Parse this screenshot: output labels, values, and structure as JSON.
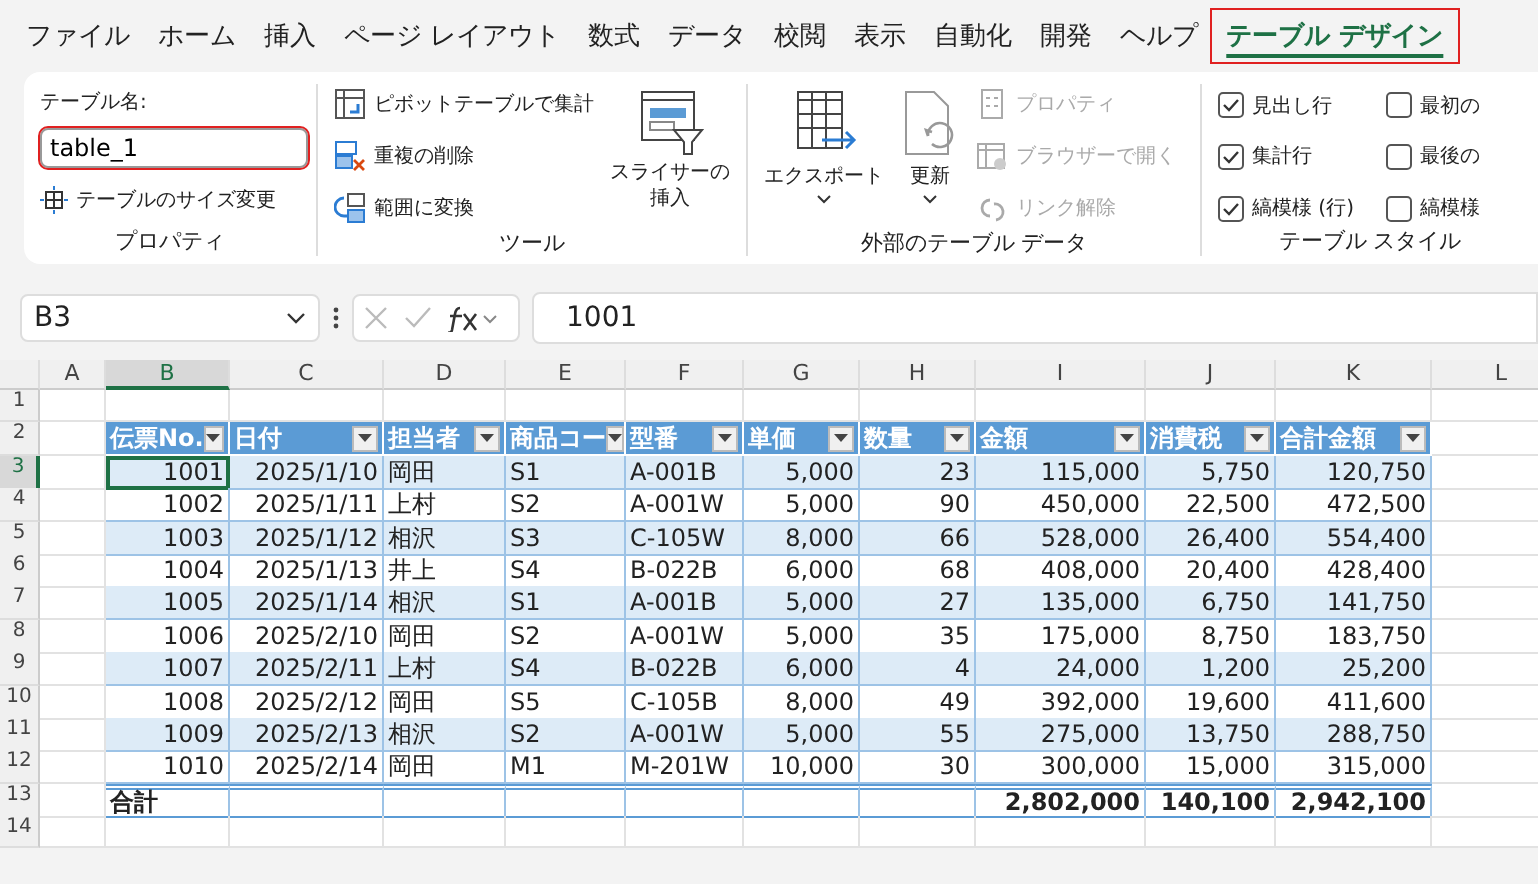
{
  "menu_tabs": [
    {
      "label": "ファイル",
      "selected": false,
      "annotated": false
    },
    {
      "label": "ホーム",
      "selected": false,
      "annotated": false
    },
    {
      "label": "挿入",
      "selected": false,
      "annotated": false
    },
    {
      "label": "ページ レイアウト",
      "selected": false,
      "annotated": false
    },
    {
      "label": "数式",
      "selected": false,
      "annotated": false
    },
    {
      "label": "データ",
      "selected": false,
      "annotated": false
    },
    {
      "label": "校閲",
      "selected": false,
      "annotated": false
    },
    {
      "label": "表示",
      "selected": false,
      "annotated": false
    },
    {
      "label": "自動化",
      "selected": false,
      "annotated": false
    },
    {
      "label": "開発",
      "selected": false,
      "annotated": false
    },
    {
      "label": "ヘルプ",
      "selected": false,
      "annotated": false
    },
    {
      "label": "テーブル デザイン",
      "selected": true,
      "annotated": true
    }
  ],
  "ribbon": {
    "properties": {
      "caption": "テーブル名:",
      "table_name": "table_1",
      "annotated": true,
      "resize_button": "テーブルのサイズ変更",
      "title": "プロパティ"
    },
    "tools": {
      "buttons": [
        {
          "label": "ピボットテーブルで集計",
          "kind": "pivot"
        },
        {
          "label": "重複の削除",
          "kind": "dedupe"
        },
        {
          "label": "範囲に変換",
          "kind": "convert"
        }
      ],
      "slicer_button": [
        "スライサーの",
        "挿入"
      ],
      "title": "ツール"
    },
    "external": {
      "export_button": "エクスポート",
      "refresh_button": "更新",
      "buttons": [
        {
          "label": "プロパティ",
          "kind": "props",
          "disabled": true
        },
        {
          "label": "ブラウザーで開く",
          "kind": "browser",
          "disabled": true
        },
        {
          "label": "リンク解除",
          "kind": "unlink",
          "disabled": true
        }
      ],
      "title": "外部のテーブル データ"
    },
    "style_options": {
      "options": [
        {
          "label": "見出し行",
          "checked": true
        },
        {
          "label": "最初の",
          "checked": false
        },
        {
          "label": "集計行",
          "checked": true
        },
        {
          "label": "最後の",
          "checked": false
        },
        {
          "label": "縞模様 (行)",
          "checked": true
        },
        {
          "label": "縞模様",
          "checked": false
        }
      ],
      "title": "テーブル スタイル"
    }
  },
  "formula_bar": {
    "name_box": "B3",
    "formula": "1001"
  },
  "sheet": {
    "columns": [
      {
        "letter": "A",
        "selected": false
      },
      {
        "letter": "B",
        "selected": true
      },
      {
        "letter": "C",
        "selected": false
      },
      {
        "letter": "D",
        "selected": false
      },
      {
        "letter": "E",
        "selected": false
      },
      {
        "letter": "F",
        "selected": false
      },
      {
        "letter": "G",
        "selected": false
      },
      {
        "letter": "H",
        "selected": false
      },
      {
        "letter": "I",
        "selected": false
      },
      {
        "letter": "J",
        "selected": false
      },
      {
        "letter": "K",
        "selected": false
      },
      {
        "letter": "L",
        "selected": false
      }
    ],
    "row_numbers": [
      {
        "label": "1",
        "selected": false
      },
      {
        "label": "2",
        "selected": false
      },
      {
        "label": "3",
        "selected": true
      },
      {
        "label": "4",
        "selected": false
      },
      {
        "label": "5",
        "selected": false
      },
      {
        "label": "6",
        "selected": false
      },
      {
        "label": "7",
        "selected": false
      },
      {
        "label": "8",
        "selected": false
      },
      {
        "label": "9",
        "selected": false
      },
      {
        "label": "10",
        "selected": false
      },
      {
        "label": "11",
        "selected": false
      },
      {
        "label": "12",
        "selected": false
      },
      {
        "label": "13",
        "selected": false
      },
      {
        "label": "14",
        "selected": false
      }
    ],
    "table": {
      "columns": [
        {
          "header": "伝票No.",
          "kind": "number"
        },
        {
          "header": "日付",
          "kind": "number"
        },
        {
          "header": "担当者",
          "kind": "text"
        },
        {
          "header": "商品コー",
          "kind": "text"
        },
        {
          "header": "型番",
          "kind": "text"
        },
        {
          "header": "単価",
          "kind": "number"
        },
        {
          "header": "数量",
          "kind": "number"
        },
        {
          "header": "金額",
          "kind": "number"
        },
        {
          "header": "消費税",
          "kind": "number"
        },
        {
          "header": "合計金額",
          "kind": "number"
        }
      ],
      "rows": [
        {
          "cells": [
            "1001",
            "2025/1/10",
            "岡田",
            "S1",
            "A-001B",
            "5,000",
            "23",
            "115,000",
            "5,750",
            "120,750"
          ],
          "selected": true
        },
        {
          "cells": [
            "1002",
            "2025/1/11",
            "上村",
            "S2",
            "A-001W",
            "5,000",
            "90",
            "450,000",
            "22,500",
            "472,500"
          ],
          "selected": false
        },
        {
          "cells": [
            "1003",
            "2025/1/12",
            "相沢",
            "S3",
            "C-105W",
            "8,000",
            "66",
            "528,000",
            "26,400",
            "554,400"
          ],
          "selected": false
        },
        {
          "cells": [
            "1004",
            "2025/1/13",
            "井上",
            "S4",
            "B-022B",
            "6,000",
            "68",
            "408,000",
            "20,400",
            "428,400"
          ],
          "selected": false
        },
        {
          "cells": [
            "1005",
            "2025/1/14",
            "相沢",
            "S1",
            "A-001B",
            "5,000",
            "27",
            "135,000",
            "6,750",
            "141,750"
          ],
          "selected": false
        },
        {
          "cells": [
            "1006",
            "2025/2/10",
            "岡田",
            "S2",
            "A-001W",
            "5,000",
            "35",
            "175,000",
            "8,750",
            "183,750"
          ],
          "selected": false
        },
        {
          "cells": [
            "1007",
            "2025/2/11",
            "上村",
            "S4",
            "B-022B",
            "6,000",
            "4",
            "24,000",
            "1,200",
            "25,200"
          ],
          "selected": false
        },
        {
          "cells": [
            "1008",
            "2025/2/12",
            "岡田",
            "S5",
            "C-105B",
            "8,000",
            "49",
            "392,000",
            "19,600",
            "411,600"
          ],
          "selected": false
        },
        {
          "cells": [
            "1009",
            "2025/2/13",
            "相沢",
            "S2",
            "A-001W",
            "5,000",
            "55",
            "275,000",
            "13,750",
            "288,750"
          ],
          "selected": false
        },
        {
          "cells": [
            "1010",
            "2025/2/14",
            "岡田",
            "M1",
            "M-201W",
            "10,000",
            "30",
            "300,000",
            "15,000",
            "315,000"
          ],
          "selected": false
        }
      ],
      "total_row": {
        "label": "合計",
        "values": [
          "2,802,000",
          "140,100",
          "2,942,100"
        ]
      }
    }
  }
}
